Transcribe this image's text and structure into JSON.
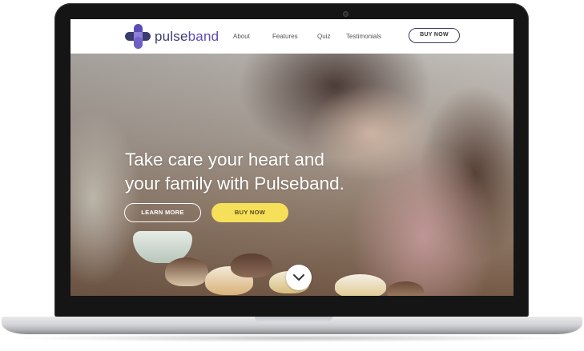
{
  "brand": {
    "name_part1": "pulse",
    "name_part2": "band",
    "logo_colors": [
      "#3b3c6e",
      "#5a4db3",
      "#8e7fd6"
    ]
  },
  "nav": {
    "links": [
      "About",
      "Features",
      "Quiz",
      "Testimonials"
    ],
    "buy_label": "BUY NOW"
  },
  "hero": {
    "title_line1": "Take care your heart and",
    "title_line2": "your family with Pulseband.",
    "learn_more_label": "LEARN MORE",
    "buy_now_label": "BUY NOW",
    "buy_color": "#f6e05a",
    "scroll_icon": "chevron-down-icon"
  }
}
